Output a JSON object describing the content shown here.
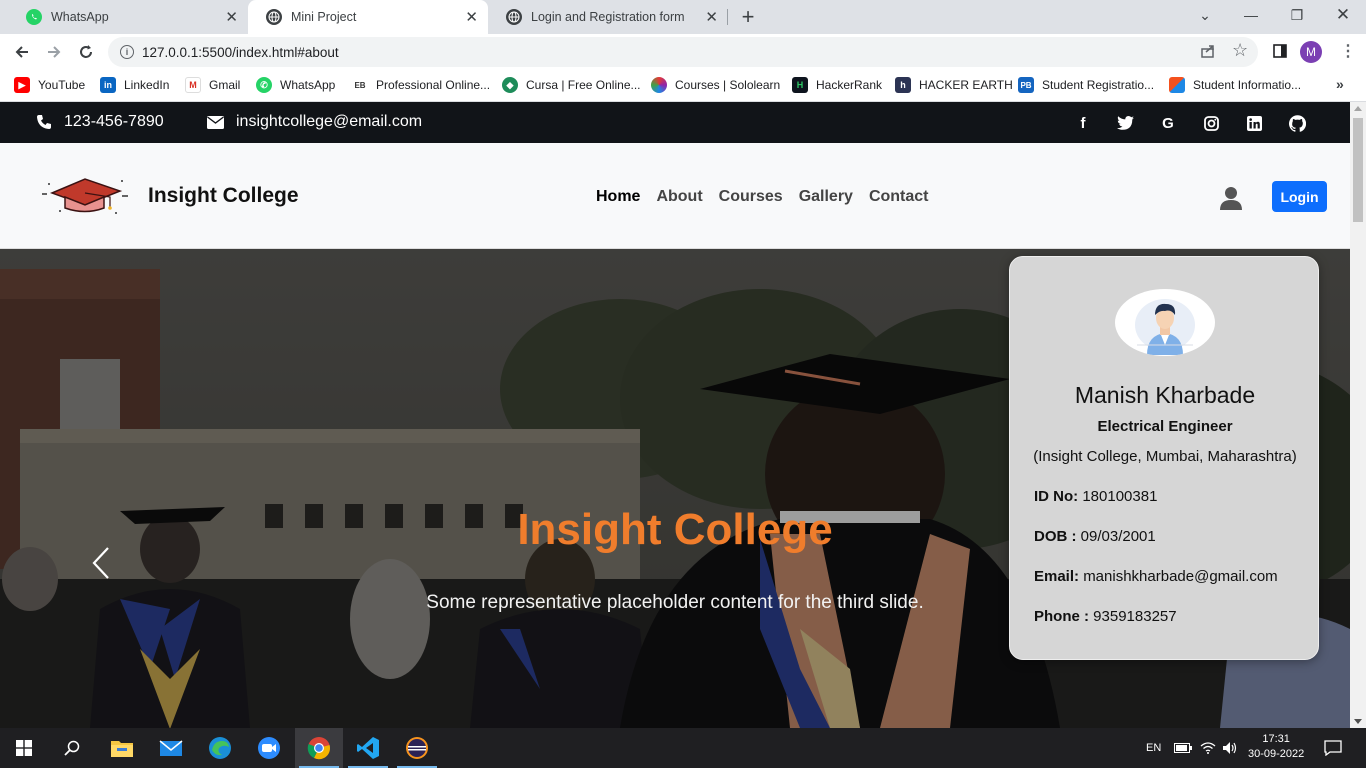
{
  "browser": {
    "tabs": [
      {
        "title": "WhatsApp",
        "active": false
      },
      {
        "title": "Mini Project",
        "active": true
      },
      {
        "title": "Login and Registration form",
        "active": false
      }
    ],
    "url": "127.0.0.1:5500/index.html#about",
    "profile_initial": "M",
    "bookmarks": [
      {
        "label": "YouTube",
        "icon": "youtube-icon"
      },
      {
        "label": "LinkedIn",
        "icon": "linkedin-icon"
      },
      {
        "label": "Gmail",
        "icon": "gmail-icon"
      },
      {
        "label": "WhatsApp",
        "icon": "whatsapp-icon"
      },
      {
        "label": "Professional Online...",
        "icon": "eb-icon"
      },
      {
        "label": "Cursa | Free Online...",
        "icon": "cursa-icon"
      },
      {
        "label": "Courses | Sololearn",
        "icon": "sololearn-icon"
      },
      {
        "label": "HackerRank",
        "icon": "hackerrank-icon"
      },
      {
        "label": "HACKER EARTH",
        "icon": "hackerearth-icon"
      },
      {
        "label": "Student Registratio...",
        "icon": "pb-icon"
      },
      {
        "label": "Student Informatio...",
        "icon": "student-info-icon"
      }
    ]
  },
  "site": {
    "topbar": {
      "phone": "123-456-7890",
      "email": "insightcollege@email.com",
      "social": [
        "facebook-icon",
        "twitter-icon",
        "google-icon",
        "instagram-icon",
        "linkedin-icon",
        "github-icon"
      ]
    },
    "brand": "Insight College",
    "nav": [
      "Home",
      "About",
      "Courses",
      "Gallery",
      "Contact"
    ],
    "login_label": "Login",
    "hero": {
      "title": "Insight College",
      "text": "Some representative placeholder content for the third slide."
    },
    "profile": {
      "name": "Manish Kharbade",
      "role": "Electrical Engineer",
      "org": "(Insight College, Mumbai, Maharashtra)",
      "id_label": "ID No:",
      "id_value": "180100381",
      "dob_label": "DOB :",
      "dob_value": "09/03/2001",
      "email_label": "Email:",
      "email_value": "manishkharbade@gmail.com",
      "phone_label": "Phone :",
      "phone_value": "9359183257"
    }
  },
  "taskbar": {
    "language": "EN",
    "time": "17:31",
    "date": "30-09-2022"
  },
  "colors": {
    "accent_orange": "#f07d2c",
    "login_blue": "#0d6efd",
    "topbar_dark": "#111418"
  }
}
